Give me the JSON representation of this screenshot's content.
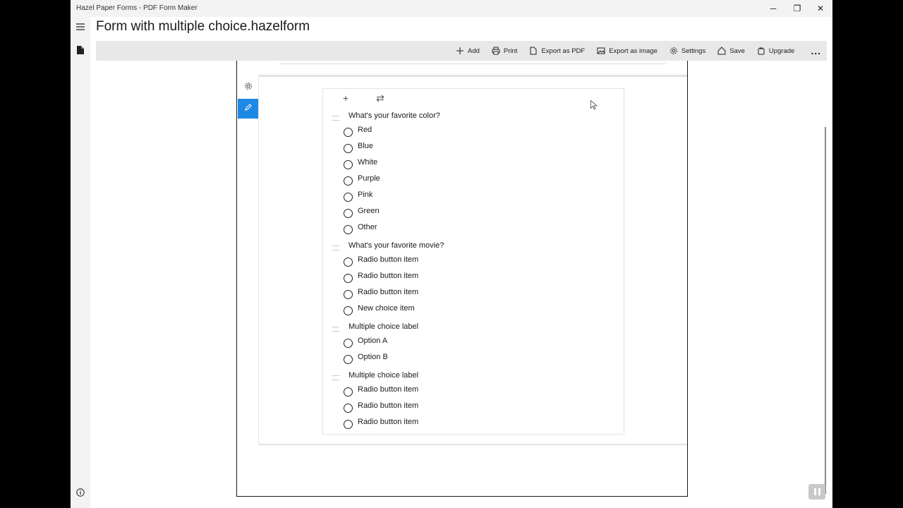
{
  "window": {
    "app_title": "Hazel Paper Forms - PDF Form Maker",
    "doc_title": "Form with multiple choice.hazelform",
    "controls": {
      "minimize": "─",
      "restore": "❐",
      "close": "✕"
    }
  },
  "rail": {
    "menu_icon": "hamburger-menu-icon",
    "file_icon": "document-icon",
    "info_icon": "info-icon"
  },
  "toolbar": {
    "items": [
      {
        "label": "Add",
        "icon": "plus-icon"
      },
      {
        "label": "Print",
        "icon": "printer-icon"
      },
      {
        "label": "Export as PDF",
        "icon": "pdf-file-icon"
      },
      {
        "label": "Export as image",
        "icon": "image-icon"
      },
      {
        "label": "Settings",
        "icon": "gear-icon"
      },
      {
        "label": "Save",
        "icon": "save-home-icon"
      },
      {
        "label": "Upgrade",
        "icon": "upgrade-bag-icon"
      }
    ],
    "more": "..."
  },
  "side_tools": {
    "settings_icon": "gear-icon",
    "edit_icon": "pencil-icon",
    "accent_color": "#1e88e5"
  },
  "card_tools": {
    "add": "+",
    "swap": "⇄"
  },
  "questions": [
    {
      "title": "What's your favorite color?",
      "options": [
        "Red",
        "Blue",
        "White",
        "Purple",
        "Pink",
        "Green",
        "Other"
      ]
    },
    {
      "title": "What's your favorite movie?",
      "options": [
        "Radio button item",
        "Radio button item",
        "Radio button item",
        "New choice item"
      ]
    },
    {
      "title": "Multiple choice label",
      "options": [
        "Option A",
        "Option B"
      ]
    },
    {
      "title": "Multiple choice label",
      "options": [
        "Radio button item",
        "Radio button item",
        "Radio button item"
      ]
    }
  ]
}
